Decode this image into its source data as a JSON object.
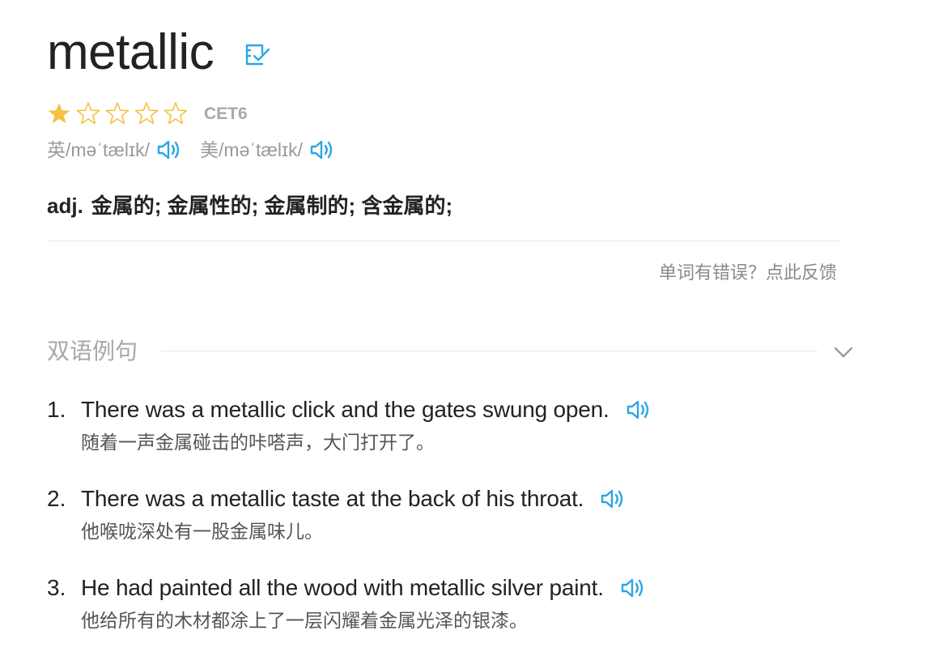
{
  "word": {
    "headword": "metallic",
    "wordbook_icon": "add-to-wordbook-icon",
    "rating": 1,
    "rating_max": 5,
    "level": "CET6",
    "star_color_filled": "#f5c242",
    "star_color_empty": "#f5c242",
    "accent_color": "#2aa6e6"
  },
  "pronunciation": {
    "uk": "英/məˈtælɪk/",
    "us": "美/məˈtælɪk/",
    "speaker_icon": "speaker-icon"
  },
  "definition": {
    "pos": "adj.",
    "meanings": "金属的; 金属性的; 金属制的; 含金属的;"
  },
  "feedback": {
    "label": "单词有错误？点此反馈"
  },
  "examples_section": {
    "title": "双语例句",
    "toggle_icon": "chevron-down-icon",
    "items": [
      {
        "num": "1.",
        "en": "There was a metallic click and the gates swung open.",
        "cn": "随着一声金属碰击的咔嗒声，大门打开了。"
      },
      {
        "num": "2.",
        "en": "There was a metallic taste at the back of his throat.",
        "cn": "他喉咙深处有一股金属味儿。"
      },
      {
        "num": "3.",
        "en": "He had painted all the wood with metallic silver paint.",
        "cn": "他给所有的木材都涂上了一层闪耀着金属光泽的银漆。"
      }
    ]
  }
}
